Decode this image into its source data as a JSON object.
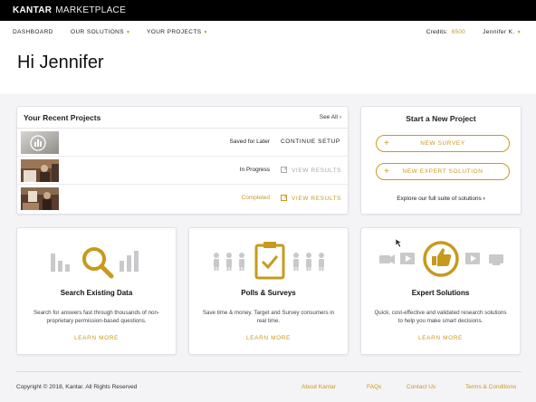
{
  "topbar": {
    "brand": "KANTAR",
    "product": "MARKETPLACE"
  },
  "nav": {
    "items": [
      "DASHBOARD",
      "OUR SOLUTIONS",
      "YOUR PROJECTS"
    ],
    "credits_label": "Credits:",
    "credits_value": "6500",
    "user": "Jennifer K."
  },
  "greeting": "Hi Jennifer",
  "recent": {
    "title": "Your Recent Projects",
    "see_all": "See All",
    "rows": [
      {
        "status": "Saved for Later",
        "action": "CONTINUE SETUP",
        "status_color": "#222222",
        "action_color": "#c79a1e",
        "action_icon": ""
      },
      {
        "status": "In Progress",
        "action": "VIEW RESULTS",
        "status_color": "#222222",
        "action_color": "#a8a8a8",
        "action_icon": "external-link-icon"
      },
      {
        "status": "Completed",
        "action": "VIEW RESULTS",
        "status_color": "#c79a1e",
        "action_color": "#c79a1e",
        "action_icon": "external-link-icon"
      }
    ]
  },
  "new_project": {
    "title": "Start a New Project",
    "new_survey": "NEW SURVEY",
    "new_expert": "NEW EXPERT SOLUTION",
    "explore": "Explore our full suite of solutions"
  },
  "features": [
    {
      "title": "Search Existing Data",
      "desc": "Search for answers fast through thousands of non-proprietary permission-based questions.",
      "learn": "LEARN MORE",
      "icon": "magnifier-chart-icon"
    },
    {
      "title": "Polls & Surveys",
      "desc": "Save time & money. Target and Survey consumers in real time.",
      "learn": "LEARN MORE",
      "icon": "clipboard-check-icon"
    },
    {
      "title": "Expert Solutions",
      "desc": "Quick, cost-effective and validated research solutions to help you make smart decisions.",
      "learn": "LEARN MORE",
      "icon": "thumbs-up-icon"
    }
  ],
  "footer": {
    "copyright": "Copyright © 2018, Kantar. All Rights Reserved",
    "links": [
      "About Kantar",
      "FAQs",
      "Contact Us",
      "Terms & Conditions"
    ]
  },
  "colors": {
    "accent": "#c79a1e",
    "topbar": "#000000",
    "background": "#f4f3f6",
    "icon_gray": "#c9c9cc"
  }
}
